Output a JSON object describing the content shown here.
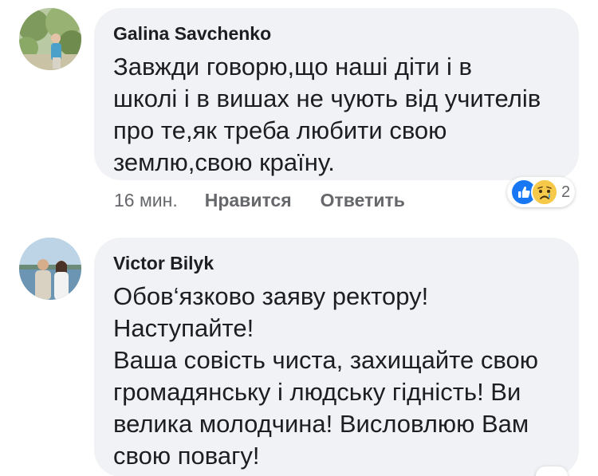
{
  "comments": [
    {
      "author": "Galina Savchenko",
      "text": "Завжди говорю,що наші діти і в\nшколі і в вишах не чують від учителів\nпро те,як треба любити свою\nземлю,свою країну.",
      "time": "16 мин.",
      "like_label": "Нравится",
      "reply_label": "Ответить",
      "reactions": {
        "icons": [
          "like-icon",
          "sad-icon"
        ],
        "count": "2"
      }
    },
    {
      "author": "Victor Bilyk",
      "text": "Обов‘язково заяву ректору!\nНаступайте!\nВаша совість чиста, захищайте свою\nгромадянську і людську гідність! Ви\nвелика молодчина! Висловлюю Вам\nсвою повагу!"
    }
  ],
  "colors": {
    "bubble": "#f0f2f5",
    "text": "#1c1e21",
    "meta": "#65676b",
    "like_blue": "#1877f2",
    "sad_yellow": "#f7c94b"
  }
}
